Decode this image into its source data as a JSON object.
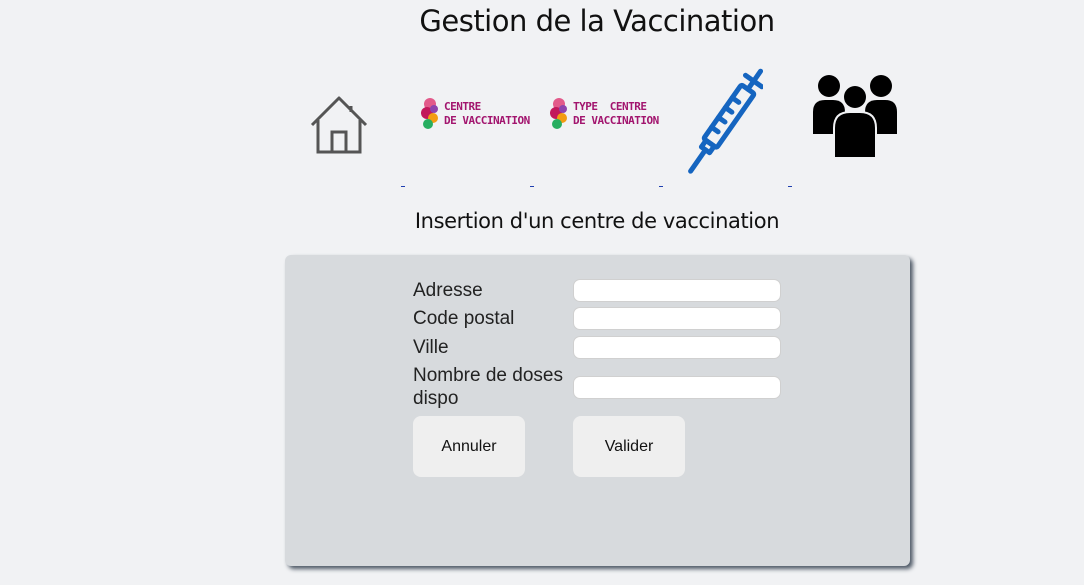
{
  "header": {
    "title": "Gestion de la Vaccination"
  },
  "nav": {
    "items": [
      {
        "name": "home",
        "icon": "house-icon"
      },
      {
        "name": "centre-de-vaccination",
        "icon": "centre-vaccination-logo",
        "text": "CENTRE\nDE VACCINATION"
      },
      {
        "name": "type-centre",
        "icon": "type-centre-logo",
        "text": "TYPE  CENTRE\nDE VACCINATION"
      },
      {
        "name": "vaccin",
        "icon": "syringe-icon"
      },
      {
        "name": "personnes",
        "icon": "people-icon"
      }
    ],
    "colors": {
      "logo_text": "#a2156e",
      "syringe": "#1565c0"
    }
  },
  "form": {
    "heading": "Insertion d'un centre de vaccination",
    "fields": [
      {
        "label": "Adresse",
        "value": ""
      },
      {
        "label": "Code postal",
        "value": ""
      },
      {
        "label": "Ville",
        "value": ""
      },
      {
        "label": "Nombre de doses\ndispo",
        "value": ""
      }
    ],
    "cancel_label": "Annuler",
    "submit_label": "Valider"
  }
}
